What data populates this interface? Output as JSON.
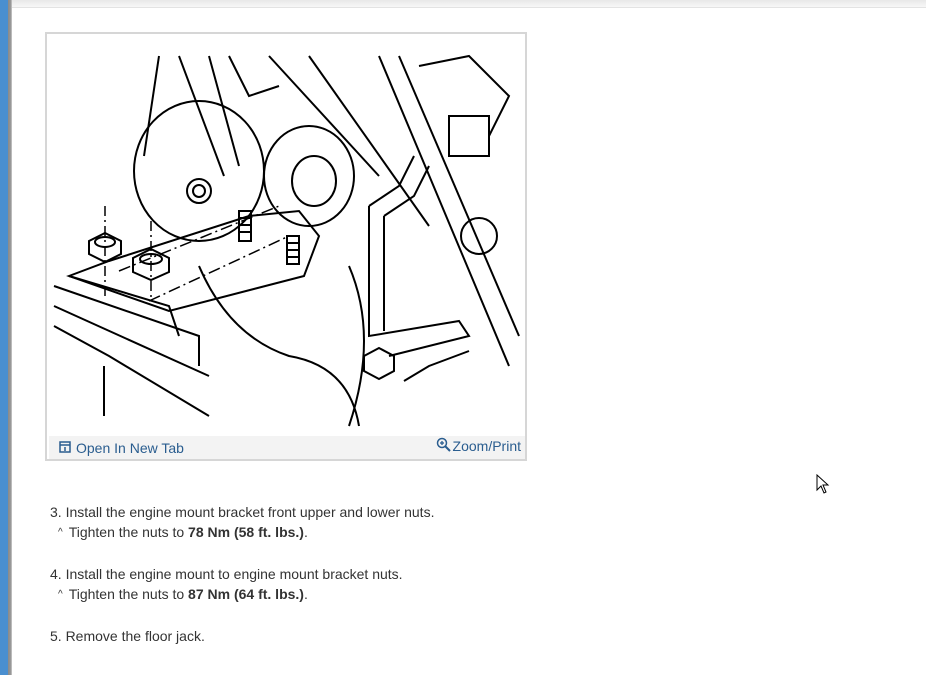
{
  "figure": {
    "open_in_new_tab_label": "Open In New Tab",
    "zoom_print_label": "Zoom/Print",
    "open_icon": "open-tab-icon",
    "zoom_icon": "zoom-in-icon"
  },
  "steps": [
    {
      "text": "3. Install the engine mount bracket front upper and lower nuts.",
      "sub_prefix": "Tighten the nuts to ",
      "sub_value": "78 Nm (58 ft. lbs.)",
      "sub_suffix": "."
    },
    {
      "text": "4. Install the engine mount to engine mount bracket nuts.",
      "sub_prefix": "Tighten the nuts to ",
      "sub_value": "87 Nm (64 ft. lbs.)",
      "sub_suffix": "."
    },
    {
      "text": "5. Remove the floor jack."
    }
  ],
  "caret_glyph": "^",
  "colors": {
    "link": "#2a5d8f",
    "text": "#333333",
    "footer_bg": "#f3f3f3",
    "left_accent": "#4a8fd0"
  }
}
